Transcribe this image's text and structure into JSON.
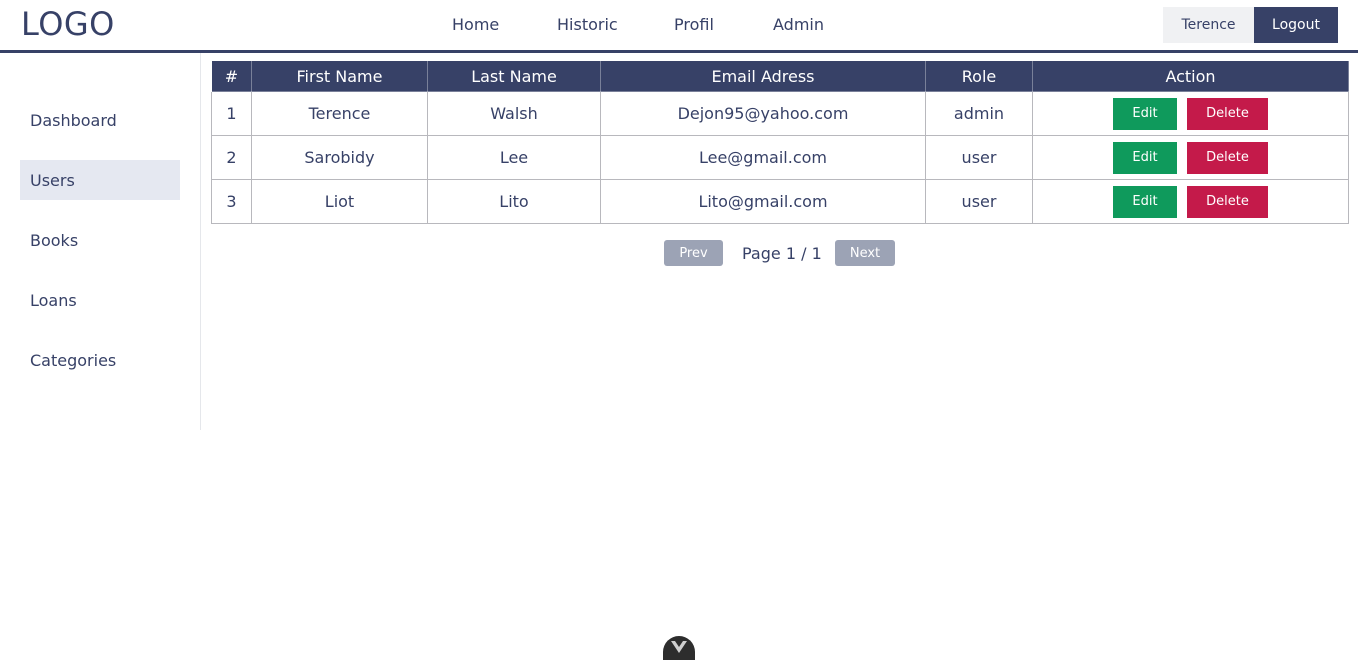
{
  "header": {
    "logo": "LOGO",
    "nav": [
      "Home",
      "Historic",
      "Profil",
      "Admin"
    ],
    "user_name": "Terence",
    "logout_label": "Logout"
  },
  "sidebar": {
    "items": [
      {
        "label": "Dashboard",
        "active": false
      },
      {
        "label": "Users",
        "active": true
      },
      {
        "label": "Books",
        "active": false
      },
      {
        "label": "Loans",
        "active": false
      },
      {
        "label": "Categories",
        "active": false
      }
    ]
  },
  "table": {
    "headers": [
      "#",
      "First Name",
      "Last Name",
      "Email Adress",
      "Role",
      "Action"
    ],
    "rows": [
      {
        "num": "1",
        "first": "Terence",
        "last": "Walsh",
        "email": "Dejon95@yahoo.com",
        "role": "admin"
      },
      {
        "num": "2",
        "first": "Sarobidy",
        "last": "Lee",
        "email": "Lee@gmail.com",
        "role": "user"
      },
      {
        "num": "3",
        "first": "Liot",
        "last": "Lito",
        "email": "Lito@gmail.com",
        "role": "user"
      }
    ],
    "edit_label": "Edit",
    "delete_label": "Delete"
  },
  "pagination": {
    "prev_label": "Prev",
    "page_text": "Page 1 / 1",
    "next_label": "Next"
  },
  "colors": {
    "primary": "#374167",
    "edit": "#0f9a5c",
    "delete": "#c41a4a",
    "active_bg": "#e5e8f1"
  },
  "icons": {
    "devtools": "vue-logo-icon"
  }
}
